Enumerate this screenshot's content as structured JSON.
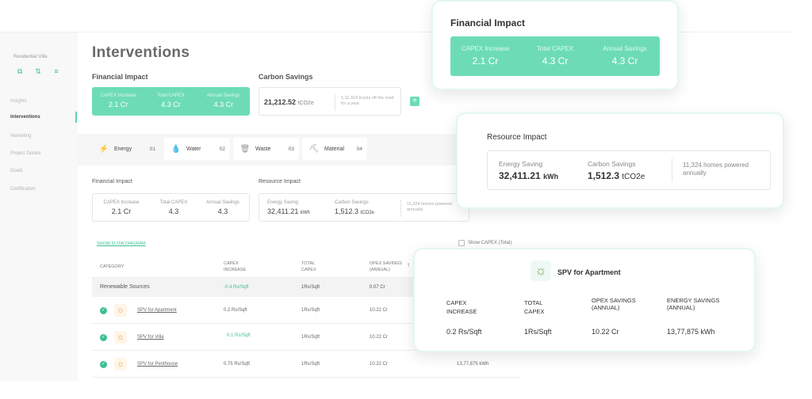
{
  "sidebar": {
    "project": "Residential Villa",
    "nav": [
      "Insights",
      "Interventions",
      "Marketing",
      "Project Details",
      "Goals",
      "Certification"
    ]
  },
  "page": {
    "title": "Interventions"
  },
  "financial_top": {
    "label": "Financial Impact",
    "items": [
      {
        "label": "CAPEX Increase",
        "value": "2.1 Cr"
      },
      {
        "label": "Total CAPEX",
        "value": "4.3 Cr"
      },
      {
        "label": "Annual Savings",
        "value": "4.3 Cr"
      }
    ]
  },
  "carbon": {
    "label": "Carbon Savings",
    "value": "21,212.52",
    "unit": "tCO2e",
    "note": "1,11,324 trucks off the road for a year"
  },
  "add_button": "+",
  "tabs": [
    {
      "name": "Energy",
      "num": "01",
      "icon": "⚡"
    },
    {
      "name": "Water",
      "num": "02",
      "icon": "💧"
    },
    {
      "name": "Waste",
      "num": "03",
      "icon": "🗑"
    },
    {
      "name": "Material",
      "num": "04",
      "icon": "⛏"
    }
  ],
  "financial_mid": {
    "label": "Financial Impact",
    "items": [
      {
        "label": "CAPEX Increase",
        "value": "2.1 Cr"
      },
      {
        "label": "Total CAPEX",
        "value": "4.3"
      },
      {
        "label": "Annual Savings",
        "value": "4.3"
      }
    ]
  },
  "resource_mid": {
    "label": "Resource Impact",
    "energy_label": "Energy Saving",
    "energy_value": "32,411.21",
    "energy_unit": "kWh",
    "carbon_label": "Carbon Savings",
    "carbon_value": "1,512.3",
    "carbon_unit": "tCO2e",
    "note": "11,324 homes powered annually"
  },
  "show_flow": "SHOW FLOW DIAGRAM",
  "show_capex": "Show CAPEX (Total)",
  "table": {
    "headers": [
      "CATEGORY",
      "CAPEX INCREASE",
      "TOTAL CAPEX",
      "OPEX SAVINGS (ANNUAL)"
    ],
    "sort_icon": "↑",
    "group": {
      "name": "Renewable Sources",
      "capex": "-0.4 Rs/Sqft",
      "total": "1Rs/Sqft",
      "opex": "0.07 Cr"
    },
    "rows": [
      {
        "name": "SPV for Apartment",
        "capex": "0.2 Rs/Sqft",
        "total": "1Rs/Sqft",
        "opex": "10.22 Cr",
        "energy": ""
      },
      {
        "name": "SPV for Villa",
        "capex": "0.1 Rs/Sqft",
        "total": "1Rs/Sqft",
        "opex": "10.22 Cr",
        "energy": ""
      },
      {
        "name": "SPV for Penthouse",
        "capex": "0.75 Rs/Sqft",
        "total": "1Rs/Sqft",
        "opex": "10.22 Cr",
        "energy": "13,77,875 kWh"
      }
    ]
  },
  "float_financial": {
    "title": "Financial Impact",
    "items": [
      {
        "label": "CAPEX Increase",
        "value": "2.1 Cr"
      },
      {
        "label": "Total CAPEX",
        "value": "4.3 Cr"
      },
      {
        "label": "Annual Savings",
        "value": "4.3 Cr"
      }
    ]
  },
  "float_resource": {
    "title": "Resource Impact",
    "energy_label": "Energy Saving",
    "energy_value": "32,411.21",
    "energy_unit": "kWh",
    "carbon_label": "Carbon Savings",
    "carbon_value": "1,512.3",
    "carbon_unit": "tCO2e",
    "note": "11,324 homes powered annually"
  },
  "float_spv": {
    "title": "SPV for Apartment",
    "headers": [
      "CAPEX INCREASE",
      "TOTAL CAPEX",
      "OPEX SAVINGS (ANNUAL)",
      "ENERGY SAVINGS (ANNUAL)"
    ],
    "values": [
      "0.2 Rs/Sqft",
      "1Rs/Sqft",
      "10.22 Cr",
      "13,77,875 kWh"
    ]
  },
  "colors": {
    "accent": "#6ddcb6",
    "accent_dark": "#3cbf96"
  }
}
